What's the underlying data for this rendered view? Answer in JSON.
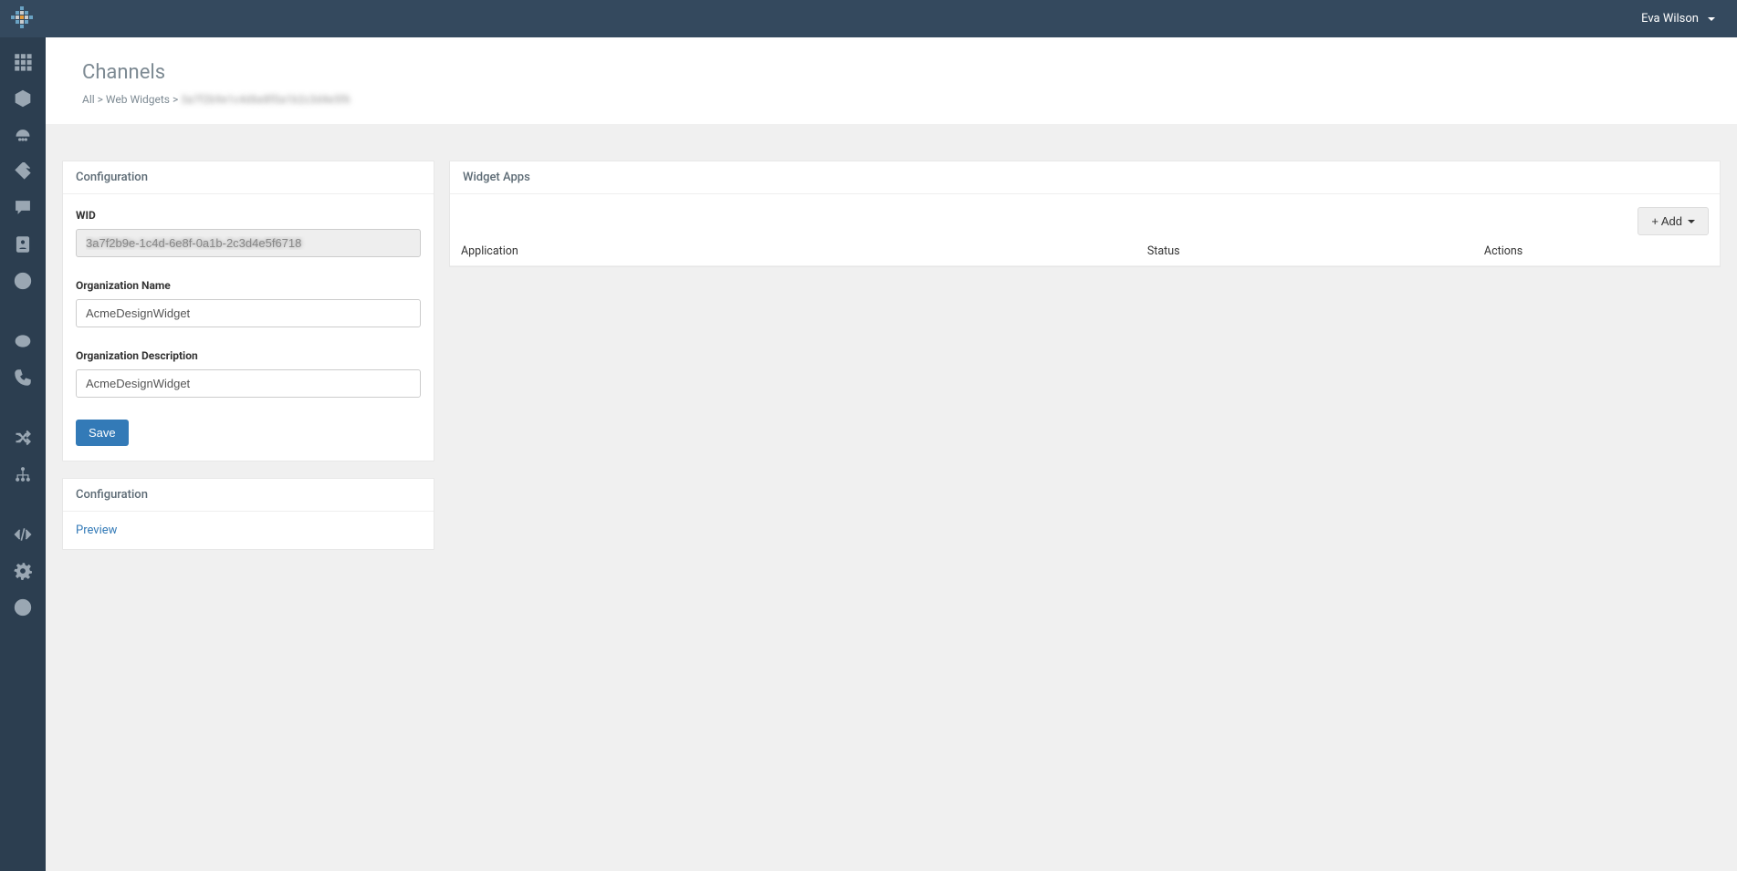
{
  "header": {
    "user_name": "Eva Wilson"
  },
  "page": {
    "title": "Channels",
    "breadcrumb_all": "All",
    "breadcrumb_web_widgets": "Web Widgets",
    "breadcrumb_current_obscured": "3a7f2b9e1c4d6e8f0a1b2c3d4e5f6"
  },
  "config_panel": {
    "title": "Configuration",
    "wid_label": "WID",
    "wid_value_obscured": "3a7f2b9e-1c4d-6e8f-0a1b-2c3d4e5f6718",
    "org_name_label": "Organization Name",
    "org_name_value": "AcmeDesignWidget",
    "org_desc_label": "Organization Description",
    "org_desc_value": "AcmeDesignWidget",
    "save_label": "Save"
  },
  "config_panel2": {
    "title": "Configuration",
    "preview_label": "Preview"
  },
  "apps_panel": {
    "title": "Widget Apps",
    "add_label": "+ Add",
    "th_application": "Application",
    "th_status": "Status",
    "th_actions": "Actions"
  }
}
